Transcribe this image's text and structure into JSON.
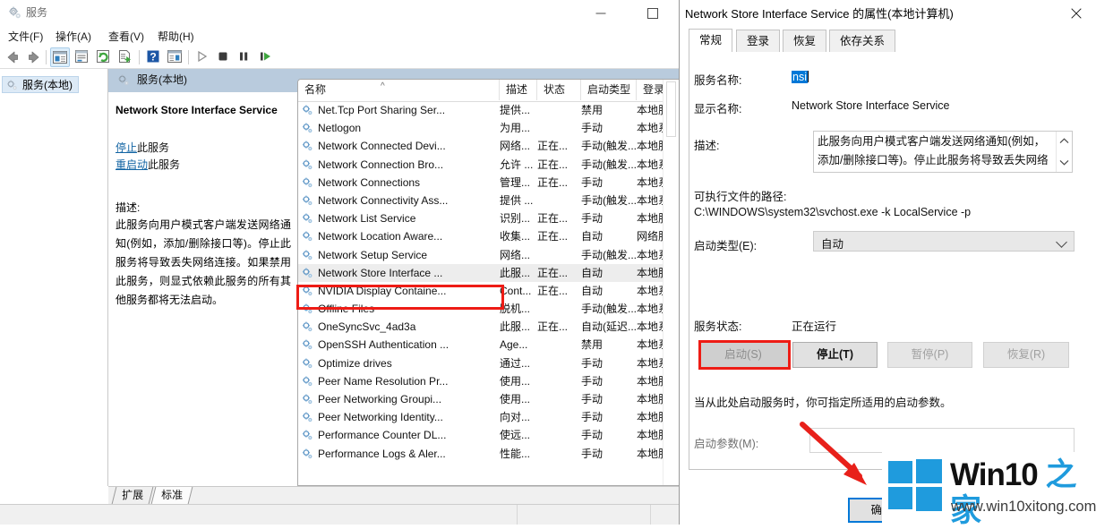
{
  "mmc": {
    "title": "服务",
    "title_icon": "services-gear-icon",
    "window_controls": {
      "minimize": "minimize-icon",
      "maximize": "maximize-icon"
    },
    "menus": [
      "文件(F)",
      "操作(A)",
      "查看(V)",
      "帮助(H)"
    ],
    "toolbar_icons": [
      "back-arrow-icon",
      "forward-arrow-icon",
      "show-hide-tree-icon",
      "properties-icon",
      "refresh-icon",
      "export-list-icon",
      "help-icon",
      "show-action-pane-icon",
      "start-service-icon",
      "stop-service-icon",
      "pause-service-icon",
      "restart-service-icon"
    ],
    "tree_node": "服务(本地)",
    "pane_header": "服务(本地)",
    "detail": {
      "title": "Network Store Interface Service",
      "link_stop_prefix": "停止",
      "link_stop_suffix": "此服务",
      "link_restart_prefix": "重启动",
      "link_restart_suffix": "此服务",
      "desc_label": "描述:",
      "desc_text": "此服务向用户模式客户端发送网络通知(例如，添加/删除接口等)。停止此服务将导致丢失网络连接。如果禁用此服务，则显式依赖此服务的所有其他服务都将无法启动。"
    },
    "list": {
      "columns": [
        "名称",
        "描述",
        "状态",
        "启动类型",
        "登录为"
      ],
      "sort_indicator": "^",
      "rows": [
        {
          "name": "Net.Tcp Port Sharing Ser...",
          "desc": "提供...",
          "status": "",
          "startup": "禁用",
          "logon": "本地服务",
          "selected": false
        },
        {
          "name": "Netlogon",
          "desc": "为用...",
          "status": "",
          "startup": "手动",
          "logon": "本地系统",
          "selected": false
        },
        {
          "name": "Network Connected Devi...",
          "desc": "网络...",
          "status": "正在...",
          "startup": "手动(触发...",
          "logon": "本地服务",
          "selected": false
        },
        {
          "name": "Network Connection Bro...",
          "desc": "允许 ...",
          "status": "正在...",
          "startup": "手动(触发...",
          "logon": "本地系统",
          "selected": false
        },
        {
          "name": "Network Connections",
          "desc": "管理...",
          "status": "正在...",
          "startup": "手动",
          "logon": "本地系统",
          "selected": false
        },
        {
          "name": "Network Connectivity Ass...",
          "desc": "提供 ...",
          "status": "",
          "startup": "手动(触发...",
          "logon": "本地系统",
          "selected": false
        },
        {
          "name": "Network List Service",
          "desc": "识别...",
          "status": "正在...",
          "startup": "手动",
          "logon": "本地服务",
          "selected": false
        },
        {
          "name": "Network Location Aware...",
          "desc": "收集...",
          "status": "正在...",
          "startup": "自动",
          "logon": "网络服务",
          "selected": false
        },
        {
          "name": "Network Setup Service",
          "desc": "网络...",
          "status": "",
          "startup": "手动(触发...",
          "logon": "本地系统",
          "selected": false
        },
        {
          "name": "Network Store Interface ...",
          "desc": "此服...",
          "status": "正在...",
          "startup": "自动",
          "logon": "本地服务",
          "selected": true
        },
        {
          "name": "NVIDIA Display Containe...",
          "desc": "Cont...",
          "status": "正在...",
          "startup": "自动",
          "logon": "本地系统",
          "selected": false
        },
        {
          "name": "Offline Files",
          "desc": "脱机...",
          "status": "",
          "startup": "手动(触发...",
          "logon": "本地系统",
          "selected": false
        },
        {
          "name": "OneSyncSvc_4ad3a",
          "desc": "此服...",
          "status": "正在...",
          "startup": "自动(延迟...",
          "logon": "本地系统",
          "selected": false
        },
        {
          "name": "OpenSSH Authentication ...",
          "desc": "Age...",
          "status": "",
          "startup": "禁用",
          "logon": "本地系统",
          "selected": false
        },
        {
          "name": "Optimize drives",
          "desc": "通过...",
          "status": "",
          "startup": "手动",
          "logon": "本地系统",
          "selected": false
        },
        {
          "name": "Peer Name Resolution Pr...",
          "desc": "使用...",
          "status": "",
          "startup": "手动",
          "logon": "本地服务",
          "selected": false
        },
        {
          "name": "Peer Networking Groupi...",
          "desc": "使用...",
          "status": "",
          "startup": "手动",
          "logon": "本地服务",
          "selected": false
        },
        {
          "name": "Peer Networking Identity...",
          "desc": "向对...",
          "status": "",
          "startup": "手动",
          "logon": "本地服务",
          "selected": false
        },
        {
          "name": "Performance Counter DL...",
          "desc": "使远...",
          "status": "",
          "startup": "手动",
          "logon": "本地服务",
          "selected": false
        },
        {
          "name": "Performance Logs & Aler...",
          "desc": "性能...",
          "status": "",
          "startup": "手动",
          "logon": "本地服务",
          "selected": false
        }
      ]
    },
    "bottom_tabs": [
      {
        "label": "扩展",
        "active": false
      },
      {
        "label": "标准",
        "active": true
      }
    ]
  },
  "dialog": {
    "title": "Network Store Interface Service 的属性(本地计算机)",
    "close_icon": "close-icon",
    "tabs": [
      {
        "label": "常规",
        "active": true
      },
      {
        "label": "登录",
        "active": false
      },
      {
        "label": "恢复",
        "active": false
      },
      {
        "label": "依存关系",
        "active": false
      }
    ],
    "service_name_label": "服务名称:",
    "service_name_value": "nsi",
    "display_name_label": "显示名称:",
    "display_name_value": "Network Store Interface Service",
    "desc_label": "描述:",
    "desc_value": "此服务向用户模式客户端发送网络通知(例如，添加/删除接口等)。停止此服务将导致丢失网络连接。如果禁用此服务，则显式依赖此服务的所有其他服务都将无法",
    "scroll_up": "▲",
    "scroll_down": "▼",
    "path_label": "可执行文件的路径:",
    "path_value": "C:\\WINDOWS\\system32\\svchost.exe -k LocalService -p",
    "startup_type_label": "启动类型(E):",
    "startup_type_value": "自动",
    "status_label": "服务状态:",
    "status_value": "正在运行",
    "buttons": [
      {
        "label": "启动(S)",
        "state": "disabled-highlighted"
      },
      {
        "label": "停止(T)",
        "state": "enabled"
      },
      {
        "label": "暂停(P)",
        "state": "disabled"
      },
      {
        "label": "恢复(R)",
        "state": "disabled"
      }
    ],
    "hint": "当从此处启动服务时，你可指定所适用的启动参数。",
    "param_label": "启动参数(M):",
    "param_value": "",
    "ok_label": "确定"
  },
  "watermark": {
    "logo": "windows-logo-icon",
    "title_main": "Win10",
    "title_accent": "之家",
    "url": "www.win10xitong.com"
  },
  "annotations": {
    "highlight_color": "#ee1c15",
    "arrow_color": "#e8201a"
  }
}
